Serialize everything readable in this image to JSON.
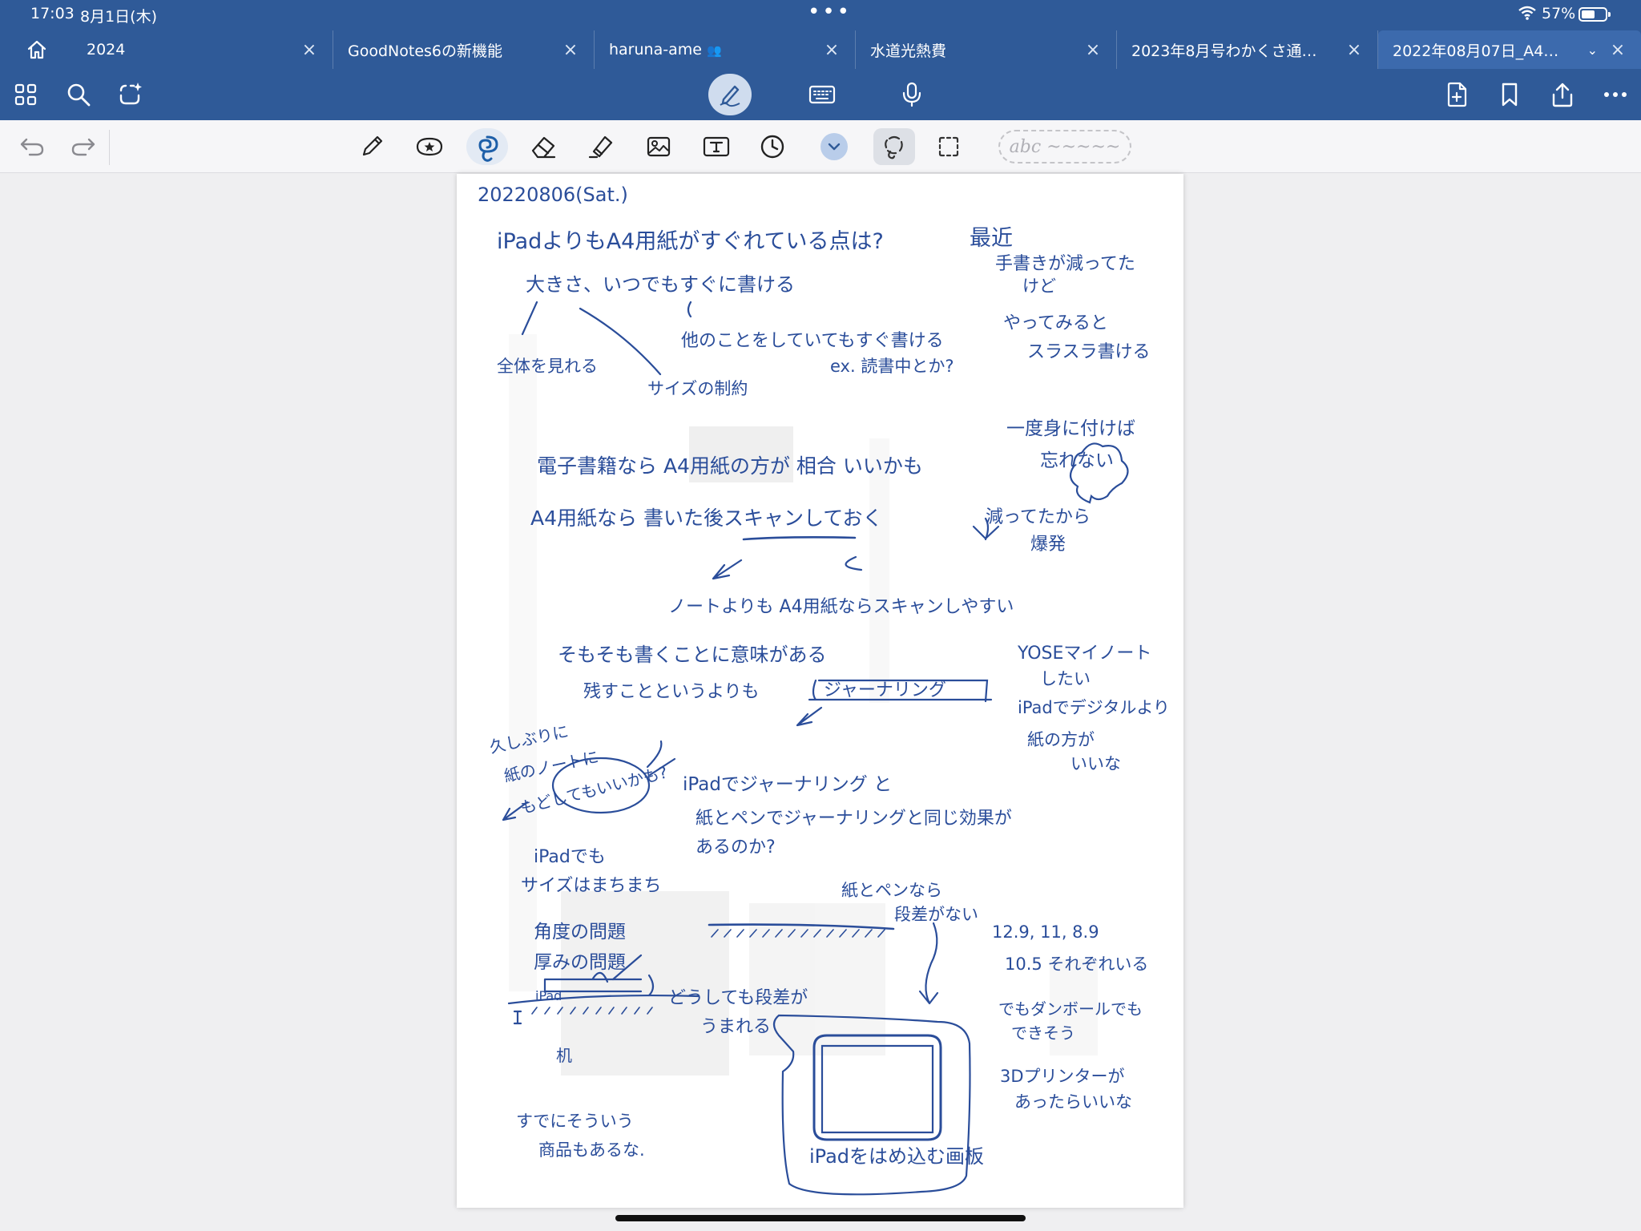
{
  "status_bar": {
    "time": "17:03",
    "date": "8月1日(木)",
    "battery": "57%",
    "battery_level": 0.57
  },
  "tabs": [
    {
      "title": "2024"
    },
    {
      "title": "GoodNotes6の新機能"
    },
    {
      "title": "haruna-ame"
    },
    {
      "title": "水道光熱費"
    },
    {
      "title": "2023年8月号わかくさ通…"
    },
    {
      "title": "2022年08月07日_A4…",
      "active": true
    }
  ],
  "toolbar": {
    "abc_placeholder": "abc ~~~~~"
  },
  "note": {
    "date": "20220806(Sat.)",
    "lines": [
      "iPadよりもA4用紙がすぐれている点は?",
      "大きさ、いつでもすぐに書ける",
      "他のことをしていてもすぐ書ける",
      "全体を見れる",
      "ex. 読書中とか?",
      "サイズの制約",
      "最近",
      "手書きが減ってた",
      "けど",
      "やってみると",
      "スラスラ書ける",
      "⇓",
      "一度身に付けば",
      "忘れない",
      "電子書籍なら A4用紙の方が 相合 いいかも",
      "A4用紙なら 書いた後スキャンしておく",
      "減ってたから",
      "爆発",
      "ノートよりも A4用紙ならスキャンしやすい",
      "そもそも書くことに意味がある",
      "残すことというよりも",
      "ジャーナリング",
      "YOSEマイノート",
      "したい",
      "iPadでデジタルより",
      "紙の方が",
      "いいな",
      "久しぶりに",
      "紙のノートに",
      "もどしてもいいかも?",
      "iPadでジャーナリング と",
      "紙とペンでジャーナリングと同じ効果が",
      "あるのか?",
      "iPadでも",
      "サイズはまちまち",
      "紙とペンなら",
      "段差がない",
      "角度の問題",
      "厚みの問題",
      "12.9, 11, 8.9",
      "10.5 それぞれいる",
      "iPad",
      "どうしても段差が",
      "うまれる",
      "机",
      "でもダンボールでも",
      "できそう",
      "3Dプリンターが",
      "あったらいいな",
      "すでにそういう",
      "商品もあるな.",
      "iPadをはめ込む画板"
    ]
  }
}
